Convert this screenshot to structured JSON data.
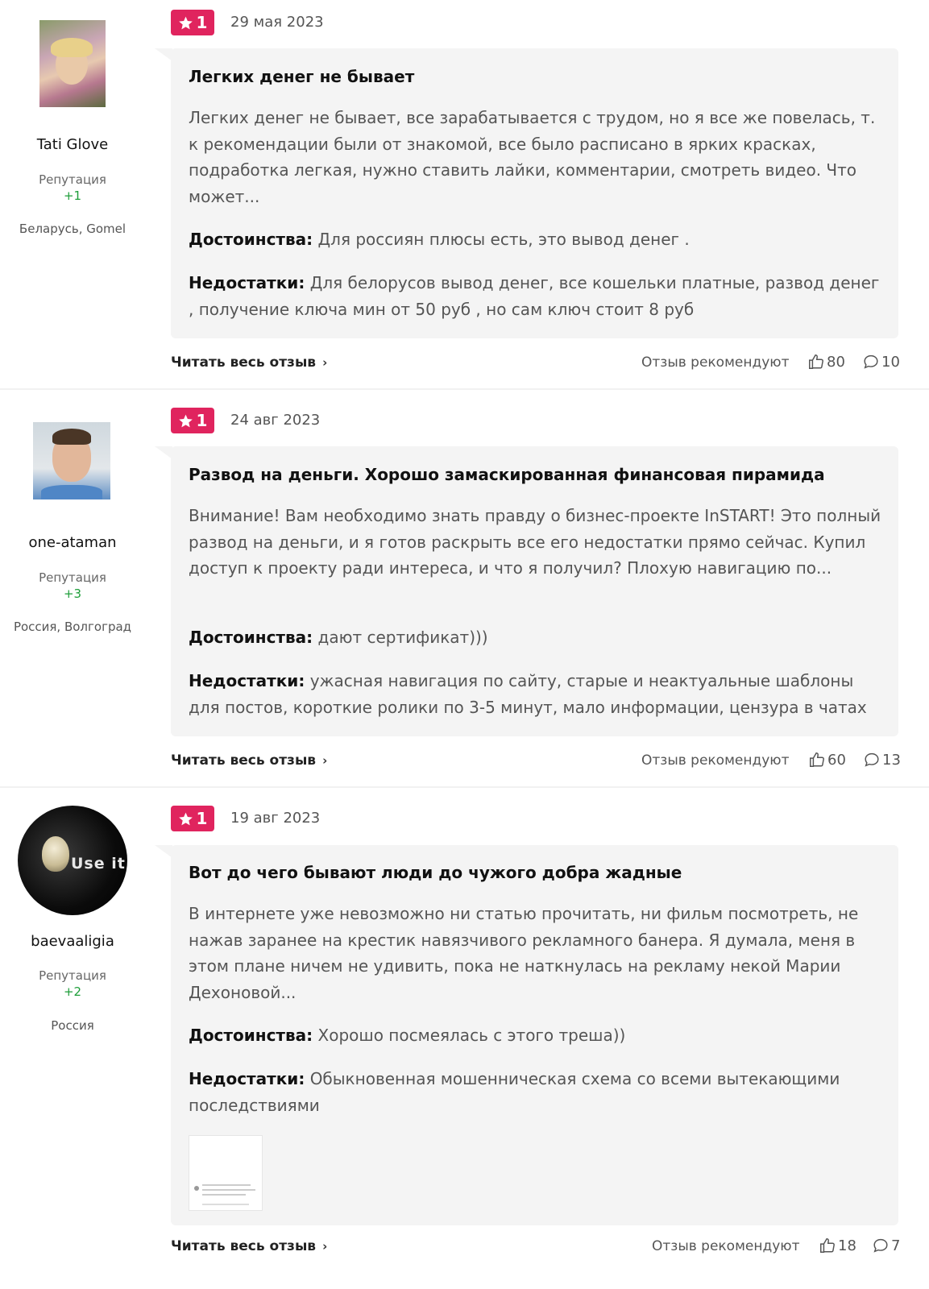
{
  "reviews": [
    {
      "author": {
        "name": "Tati Glove",
        "reputation_label": "Репутация",
        "reputation_value": "+1",
        "location": "Беларусь, Gomel",
        "avatar_icon": "avatar-photo-woman-flowers"
      },
      "rating": "1",
      "date": "29 мая 2023",
      "title": "Легких денег не бывает",
      "body": "Легких денег не бывает, все зарабатывается с трудом, но я все же повелась, т. к рекомендации были от знакомой, все было расписано в ярких красках, подработка легкая, нужно ставить лайки, комментарии, смотреть видео. Что может...",
      "pros_label": "Достоинства:",
      "pros": "Для россиян плюсы есть, это вывод денег .",
      "cons_label": "Недостатки:",
      "cons": "Для белорусов вывод денег, все кошельки платные, развод денег , получение ключа мин от 50 руб , но сам ключ стоит 8 руб",
      "read_more": "Читать весь отзыв",
      "recommend_label": "Отзыв рекомендуют",
      "likes": "80",
      "comments": "10"
    },
    {
      "author": {
        "name": "one-ataman",
        "reputation_label": "Репутация",
        "reputation_value": "+3",
        "location": "Россия, Волгоград",
        "avatar_icon": "avatar-photo-man"
      },
      "rating": "1",
      "date": "24 авг 2023",
      "title": "Развод на деньги. Хорошо замаскированная финансовая пирамида",
      "body": "Внимание! Вам необходимо знать правду о бизнес-проекте InSTART! Это полный развод на деньги, и я готов раскрыть все его недостатки прямо сейчас. Купил доступ к проекту ради интереса, и что я получил? Плохую навигацию по...",
      "pros_label": "Достоинства:",
      "pros": "дают сертификат)))",
      "cons_label": "Недостатки:",
      "cons": "ужасная навигация по сайту, старые и неактуальные шаблоны для постов, короткие ролики по 3-5 минут, мало информации, цензура в чатах",
      "read_more": "Читать весь отзыв",
      "recommend_label": "Отзыв рекомендуют",
      "likes": "60",
      "comments": "13"
    },
    {
      "author": {
        "name": "baevaaligia",
        "reputation_label": "Репутация",
        "reputation_value": "+2",
        "location": "Россия",
        "avatar_text": "Use it",
        "avatar_icon": "avatar-brain-logo"
      },
      "rating": "1",
      "date": "19 авг 2023",
      "title": "Вот до чего бывают люди до чужого добра жадные",
      "body": "В интернете уже невозможно ни статью прочитать, ни фильм посмотреть, не нажав заранее на крестик навязчивого рекламного банера. Я думала, меня в этом плане ничем не удивить, пока не наткнулась на рекламу некой Марии Дехоновой...",
      "pros_label": "Достоинства:",
      "pros": "Хорошо посмеялась с этого треша))",
      "cons_label": "Недостатки:",
      "cons": "Обыкновенная мошенническая схема со всеми вытекающими последствиями",
      "read_more": "Читать весь отзыв",
      "recommend_label": "Отзыв рекомендуют",
      "likes": "18",
      "comments": "7"
    }
  ],
  "colors": {
    "badge": "#e0245e",
    "reputation": "#1e9e3a",
    "card": "#f4f4f4"
  }
}
